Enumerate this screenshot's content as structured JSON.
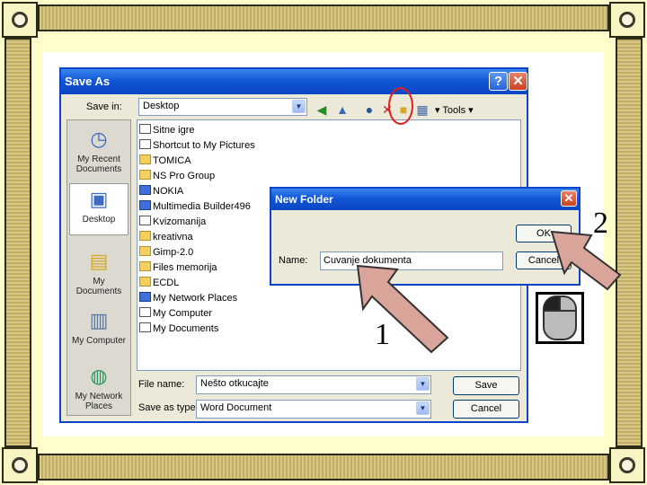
{
  "save_as": {
    "title": "Save As",
    "help_glyph": "?",
    "close_glyph": "✕",
    "save_in_label": "Save in:",
    "save_in_value": "Desktop",
    "tools_label": "Tools",
    "places": [
      "My Recent Documents",
      "Desktop",
      "My Documents",
      "My Computer",
      "My Network Places"
    ],
    "files": [
      "Sitne igre",
      "Shortcut to My Pictures",
      "TOMICA",
      "NS Pro Group",
      "NOKIA",
      "Multimedia Builder496",
      "Kvizomanija",
      "kreativna",
      "Gimp-2.0",
      "Files memorija",
      "ECDL",
      "My Network Places",
      "My Computer",
      "My Documents"
    ],
    "file_name_label": "File name:",
    "file_name_value": "Nešto otkucajte",
    "save_as_type_label": "Save as type:",
    "save_as_type_value": "Word Document",
    "save_button": "Save",
    "cancel_button": "Cancel"
  },
  "new_folder": {
    "title": "New Folder",
    "close_glyph": "✕",
    "name_label": "Name:",
    "name_value": "Cuvanje dokumenta",
    "ok_button": "OK",
    "cancel_button": "Cancel"
  },
  "callouts": {
    "one": "1",
    "two": "2"
  },
  "icons": {
    "back": "back-arrow-icon",
    "up": "up-folder-icon",
    "search": "search-web-icon",
    "delete": "delete-icon",
    "new_folder": "new-folder-icon",
    "views": "views-icon",
    "mouse": "mouse-left-click-icon"
  },
  "colors": {
    "title_blue": "#0b44c8",
    "callout_red": "#e0201a",
    "slide_bg": "#ffffcc"
  }
}
